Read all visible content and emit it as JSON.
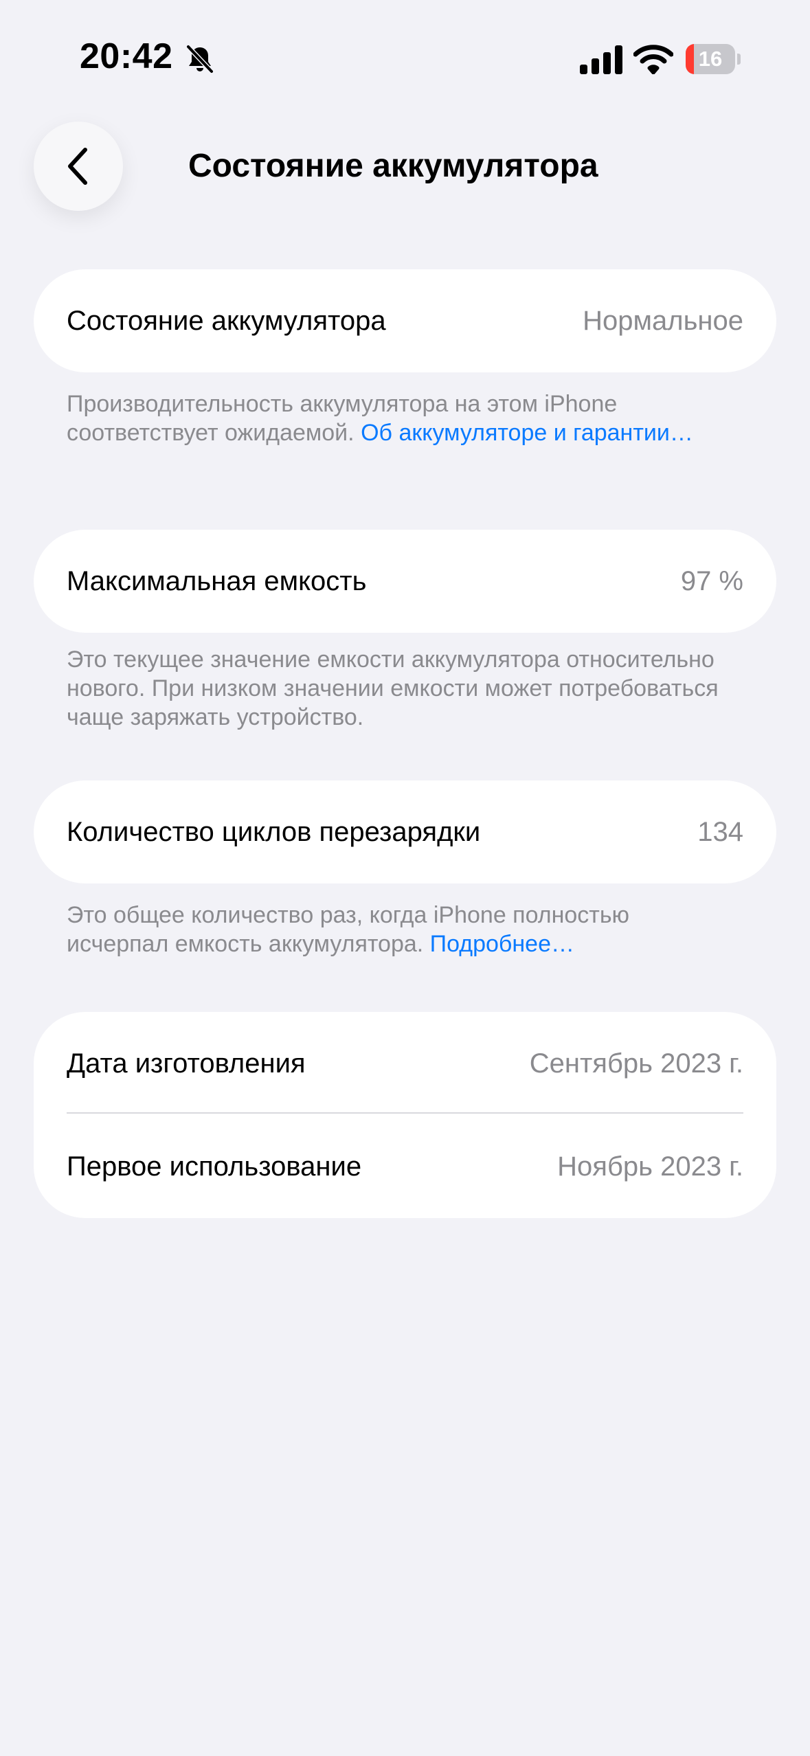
{
  "status_bar": {
    "time": "20:42",
    "battery_level": "16",
    "battery_fraction": 0.16,
    "icons": [
      "bell-slash-icon",
      "cellular-signal-icon",
      "wifi-icon",
      "battery-icon"
    ]
  },
  "nav": {
    "back_icon": "chevron-left-icon",
    "title": "Состояние аккумулятора"
  },
  "health": {
    "label": "Состояние аккумулятора",
    "value": "Нормальное",
    "footnote_text": "Производительность аккумулятора на этом iPhone соответствует ожидаемой. ",
    "footnote_link": "Об аккумуляторе и гарантии…"
  },
  "capacity": {
    "label": "Максимальная емкость",
    "value": "97 %",
    "footnote_text": "Это текущее значение емкости аккумулятора относительно нового. При низком значении емкости может потребоваться чаще заряжать устройство."
  },
  "cycles": {
    "label": "Количество циклов перезарядки",
    "value": "134",
    "footnote_text": "Это общее количество раз, когда iPhone полностью исчерпал емкость аккумулятора. ",
    "footnote_link": "Подробнее…"
  },
  "dates": {
    "manufacture_label": "Дата изготовления",
    "manufacture_value": "Сентябрь 2023 г.",
    "first_use_label": "Первое использование",
    "first_use_value": "Ноябрь 2023 г."
  },
  "colors": {
    "background": "#f2f2f7",
    "card": "#ffffff",
    "secondary_text": "#8a8a8e",
    "link": "#0a7aff",
    "battery_low": "#ff3b30"
  }
}
